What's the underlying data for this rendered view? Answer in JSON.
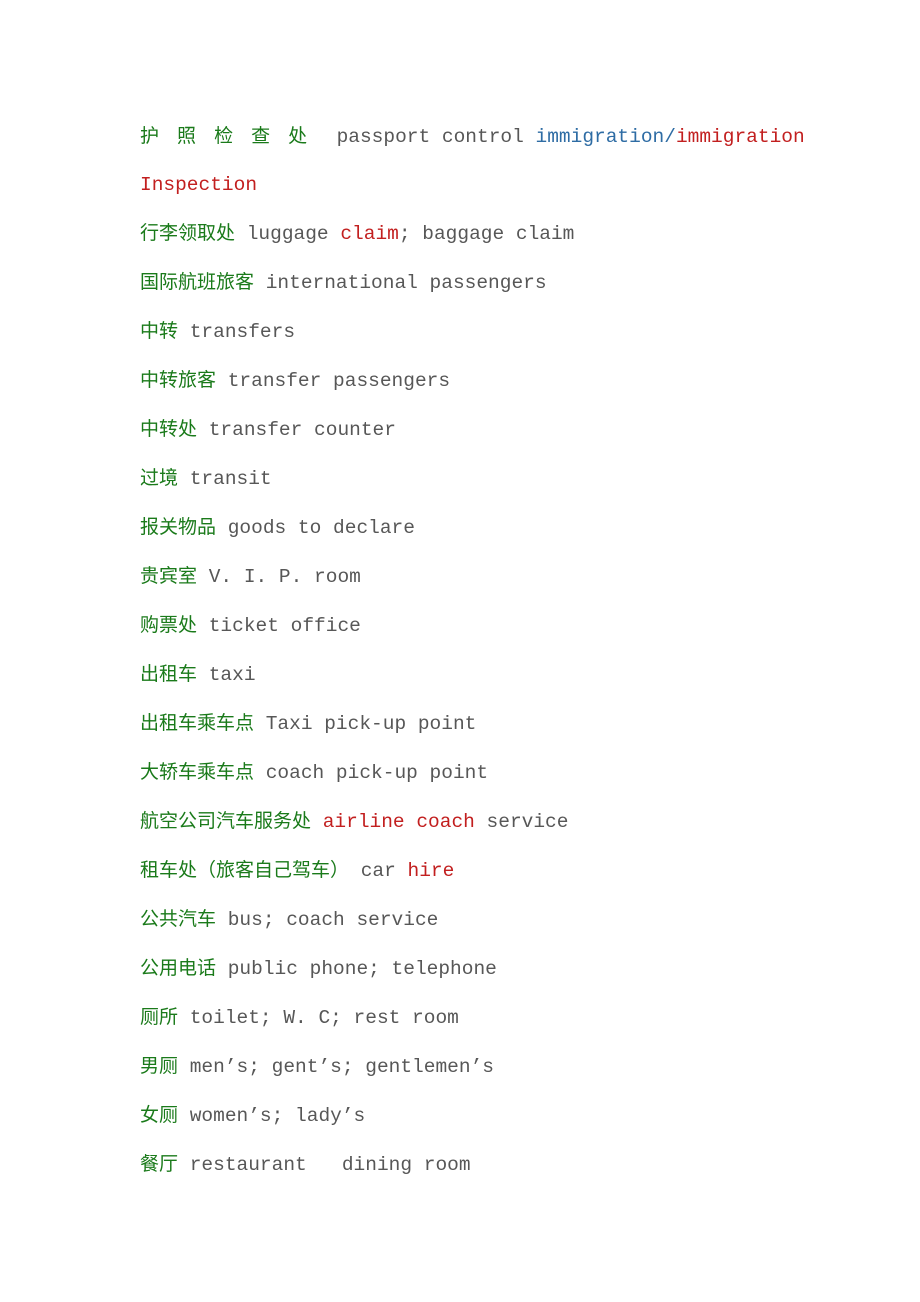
{
  "document": {
    "title": "Airport Signs Chinese-English Glossary",
    "background_color": "#ffffff",
    "colors": {
      "chinese_green": "#1a7a1a",
      "english_gray": "#575757",
      "highlight_red": "#c21f1f",
      "highlight_blue": "#2e6ca4"
    },
    "entries": [
      {
        "id": "entry-1",
        "chinese": "护 照 检 查 处",
        "chinese_spaced": true,
        "english_plain": "  passport control immigration/immigration Inspection",
        "segments": [
          {
            "text": "  passport control ",
            "color": "gray"
          },
          {
            "text": "immigration/",
            "color": "blue"
          },
          {
            "text": "immigration Inspection",
            "color": "red"
          }
        ]
      },
      {
        "id": "entry-2",
        "chinese": "行李领取处",
        "chinese_spaced": false,
        "english_plain": " luggage claim; baggage claim",
        "segments": [
          {
            "text": " luggage ",
            "color": "gray"
          },
          {
            "text": "claim",
            "color": "red"
          },
          {
            "text": "; baggage claim",
            "color": "gray"
          }
        ]
      },
      {
        "id": "entry-3",
        "chinese": "国际航班旅客",
        "chinese_spaced": false,
        "english_plain": " international passengers",
        "segments": [
          {
            "text": " international passengers",
            "color": "gray"
          }
        ]
      },
      {
        "id": "entry-4",
        "chinese": "中转",
        "chinese_spaced": false,
        "english_plain": " transfers",
        "segments": [
          {
            "text": " transfers",
            "color": "gray"
          }
        ]
      },
      {
        "id": "entry-5",
        "chinese": "中转旅客",
        "chinese_spaced": false,
        "english_plain": " transfer passengers",
        "segments": [
          {
            "text": " transfer passengers",
            "color": "gray"
          }
        ]
      },
      {
        "id": "entry-6",
        "chinese": "中转处",
        "chinese_spaced": false,
        "english_plain": " transfer counter",
        "segments": [
          {
            "text": " transfer counter",
            "color": "gray"
          }
        ]
      },
      {
        "id": "entry-7",
        "chinese": "过境",
        "chinese_spaced": false,
        "english_plain": " transit",
        "segments": [
          {
            "text": " transit",
            "color": "gray"
          }
        ]
      },
      {
        "id": "entry-8",
        "chinese": "报关物品",
        "chinese_spaced": false,
        "english_plain": " goods to declare",
        "segments": [
          {
            "text": " goods to declare",
            "color": "gray"
          }
        ]
      },
      {
        "id": "entry-9",
        "chinese": "贵宾室",
        "chinese_spaced": false,
        "english_plain": " V. I. P. room",
        "segments": [
          {
            "text": " V. I. P. room",
            "color": "gray"
          }
        ]
      },
      {
        "id": "entry-10",
        "chinese": "购票处",
        "chinese_spaced": false,
        "english_plain": " ticket office",
        "segments": [
          {
            "text": " ticket office",
            "color": "gray"
          }
        ]
      },
      {
        "id": "entry-11",
        "chinese": "出租车",
        "chinese_spaced": false,
        "english_plain": " taxi",
        "segments": [
          {
            "text": " taxi",
            "color": "gray"
          }
        ]
      },
      {
        "id": "entry-12",
        "chinese": "出租车乘车点",
        "chinese_spaced": false,
        "english_plain": " Taxi pick-up point",
        "segments": [
          {
            "text": " Taxi pick-up point",
            "color": "gray"
          }
        ]
      },
      {
        "id": "entry-13",
        "chinese": "大轿车乘车点",
        "chinese_spaced": false,
        "english_plain": " coach pick-up point",
        "segments": [
          {
            "text": " coach pick-up point",
            "color": "gray"
          }
        ]
      },
      {
        "id": "entry-14",
        "chinese": "航空公司汽车服务处",
        "chinese_spaced": false,
        "english_plain": " airline coach service",
        "segments": [
          {
            "text": " ",
            "color": "gray"
          },
          {
            "text": "airline coach",
            "color": "red"
          },
          {
            "text": " service",
            "color": "gray"
          }
        ]
      },
      {
        "id": "entry-15",
        "chinese": "租车处（旅客自己驾车）",
        "chinese_spaced": false,
        "english_plain": " car hire",
        "segments": [
          {
            "text": " car ",
            "color": "gray"
          },
          {
            "text": "hire",
            "color": "red"
          }
        ]
      },
      {
        "id": "entry-16",
        "chinese": "公共汽车",
        "chinese_spaced": false,
        "english_plain": " bus; coach service",
        "segments": [
          {
            "text": " bus; coach service",
            "color": "gray"
          }
        ]
      },
      {
        "id": "entry-17",
        "chinese": "公用电话",
        "chinese_spaced": false,
        "english_plain": " public phone; telephone",
        "segments": [
          {
            "text": " public phone; telephone",
            "color": "gray"
          }
        ]
      },
      {
        "id": "entry-18",
        "chinese": "厕所",
        "chinese_spaced": false,
        "english_plain": " toilet; W. C; rest room",
        "segments": [
          {
            "text": " toilet; W. C; rest room",
            "color": "gray"
          }
        ]
      },
      {
        "id": "entry-19",
        "chinese": "男厕",
        "chinese_spaced": false,
        "english_plain": " men’s; gent’s; gentlemen’s",
        "segments": [
          {
            "text": " men’s; gent’s; gentlemen’s",
            "color": "gray"
          }
        ]
      },
      {
        "id": "entry-20",
        "chinese": "女厕",
        "chinese_spaced": false,
        "english_plain": " women’s; lady’s",
        "segments": [
          {
            "text": " women’s; lady’s",
            "color": "gray"
          }
        ]
      },
      {
        "id": "entry-21",
        "chinese": "餐厅",
        "chinese_spaced": false,
        "english_plain": " restaurant   dining room",
        "segments": [
          {
            "text": " restaurant   dining room",
            "color": "gray"
          }
        ]
      }
    ]
  }
}
